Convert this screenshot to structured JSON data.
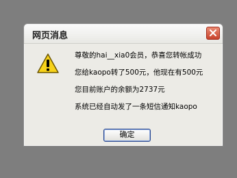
{
  "dialog": {
    "title": "网页消息",
    "icon": "warning-icon",
    "messages": [
      "尊敬的hai__xia0会员，恭喜您转帐成功",
      "您给kaopo转了500元，他现在有500元",
      "您目前账户的余额为2737元",
      "系统已经自动发了一条短信通知kaopo"
    ],
    "ok_label": "确定"
  }
}
